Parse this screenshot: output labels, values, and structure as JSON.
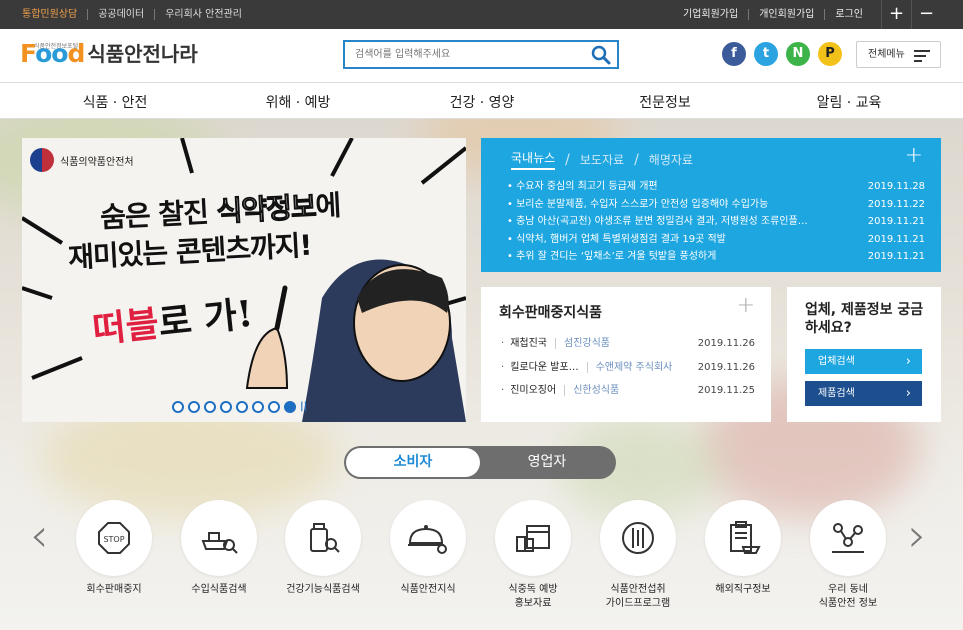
{
  "topbar": {
    "left": [
      "통합민원상담",
      "공공데이터",
      "우리회사 안전관리"
    ],
    "right": [
      "기업회원가입",
      "개인회원가입",
      "로그인"
    ],
    "zoom_in": "+",
    "zoom_out": "−"
  },
  "header": {
    "logo_tagline": "식품안전정보포털",
    "logo_food": "Food",
    "logo_name": "식품안전나라",
    "search_placeholder": "검색어를 입력해주세요",
    "sns": [
      "f",
      "t",
      "N",
      "P"
    ],
    "all_menu": "전체메뉴"
  },
  "nav": [
    "식품 · 안전",
    "위해 · 예방",
    "건강 · 영양",
    "전문정보",
    "알림 · 교육"
  ],
  "banner": {
    "agency": "식품의약품안전처",
    "line1_a": "숨은 찰진 ",
    "line1_b": "식약정보",
    "line1_c": "에",
    "line2": "재미있는 콘텐츠까지!",
    "line3_a": "떠블",
    "line3_b": "로 가!",
    "total_slides": 8,
    "active_slide": 8
  },
  "news": {
    "tabs": [
      "국내뉴스",
      "보도자료",
      "해명자료"
    ],
    "active_tab": "국내뉴스",
    "items": [
      {
        "title": "수요자 중심의 최고기 등급제 개편",
        "date": "2019.11.28"
      },
      {
        "title": "보리순 분말제품, 수입자 스스로가 안전성 입증해야 수입가능",
        "date": "2019.11.22"
      },
      {
        "title": "충남 아산(곡교천) 야생조류 분변 정밀검사 결과, 저병원성 조류인플…",
        "date": "2019.11.21"
      },
      {
        "title": "식약처, 햄버거 업체 특별위생점검 결과 19곳 적발",
        "date": "2019.11.21"
      },
      {
        "title": "추위 잘 견디는 ‘잎채소’로 겨울 텃밭을 풍성하게",
        "date": "2019.11.21"
      }
    ]
  },
  "recall": {
    "title": "회수판매중지식품",
    "items": [
      {
        "product": "재첩진국",
        "company": "섬진강식품",
        "date": "2019.11.26"
      },
      {
        "product": "킬로다운 발포…",
        "company": "수앤제약 주식회사",
        "date": "2019.11.26"
      },
      {
        "product": "진미오징어",
        "company": "신한성식품",
        "date": "2019.11.25"
      }
    ]
  },
  "biz": {
    "title": "업체, 제품정보 궁금하세요?",
    "btn_company": "업체검색",
    "btn_product": "제품검색"
  },
  "toggle": {
    "consumer": "소비자",
    "business": "영업자"
  },
  "services": [
    {
      "label": "회수판매중지",
      "icon": "stop-icon"
    },
    {
      "label": "수입식품검색",
      "icon": "ship-search-icon"
    },
    {
      "label": "건강기능식품검색",
      "icon": "supplement-search-icon"
    },
    {
      "label": "식품안전지식",
      "icon": "cloche-search-icon"
    },
    {
      "label": "식중독 예방\n홍보자료",
      "icon": "calendar-bottles-icon"
    },
    {
      "label": "식품안전섭취\n가이드프로그램",
      "icon": "plate-icon"
    },
    {
      "label": "해외직구정보",
      "icon": "clipboard-ship-icon"
    },
    {
      "label": "우리 동네\n식품안전 정보",
      "icon": "network-icon"
    }
  ],
  "colors": {
    "accent": "#1ea6e0",
    "brand_orange": "#f29020",
    "dark_button": "#1d4f8f"
  }
}
